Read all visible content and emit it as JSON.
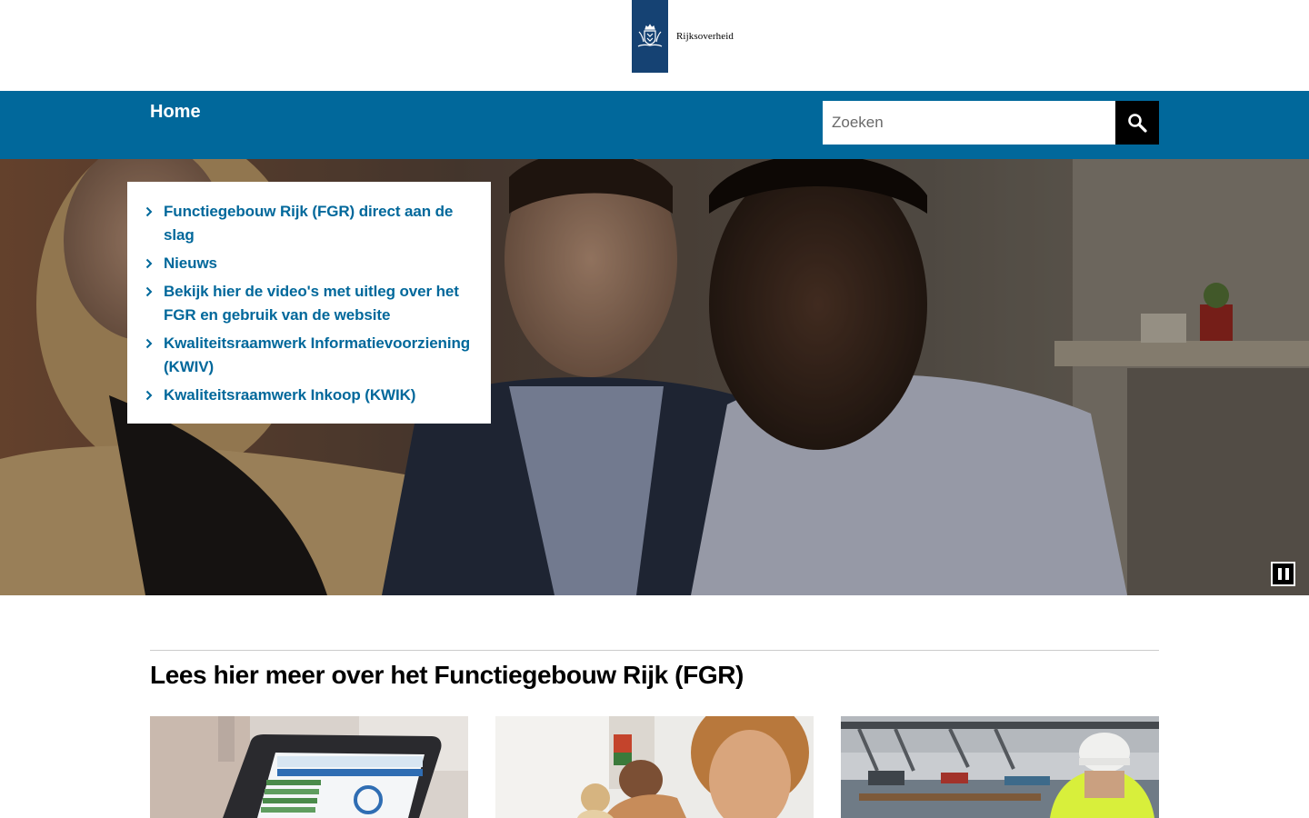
{
  "header": {
    "logo_text": "Rijksoverheid"
  },
  "nav": {
    "home_label": "Home",
    "search_placeholder": "Zoeken"
  },
  "hero": {
    "quicklinks": [
      {
        "label": "Functiegebouw Rijk (FGR) direct aan de slag"
      },
      {
        "label": "Nieuws"
      },
      {
        "label": "Bekijk hier de video's met uitleg over het FGR en gebruik van de website"
      },
      {
        "label": "Kwaliteitsraamwerk Informatievoorziening (KWIV)"
      },
      {
        "label": "Kwaliteitsraamwerk Inkoop (KWIK)"
      }
    ]
  },
  "section": {
    "title": "Lees hier meer over het Functiegebouw Rijk (FGR)"
  },
  "colors": {
    "brand_blue": "#154273",
    "nav_blue": "#01689b",
    "link_blue": "#01689b"
  },
  "icons": [
    "crest-icon",
    "search-icon",
    "chevron-right-icon",
    "pause-icon"
  ]
}
